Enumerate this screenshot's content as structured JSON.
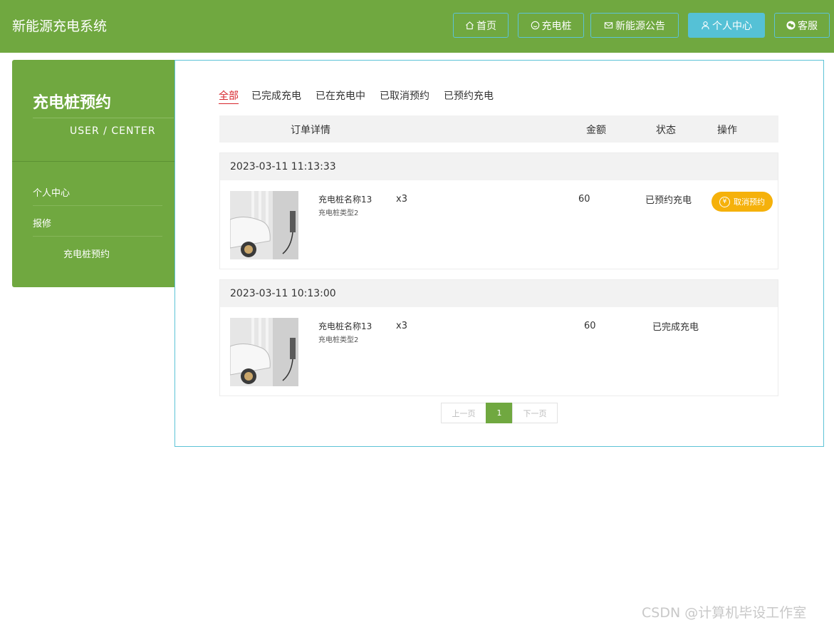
{
  "header": {
    "brand": "新能源充电系统",
    "nav": [
      "首页",
      "充电桩",
      "新能源公告",
      "个人中心",
      "客服"
    ]
  },
  "sidebar": {
    "title": "充电桩预约",
    "subtitle": "USER / CENTER",
    "items": [
      "个人中心",
      "报修",
      "充电桩预约"
    ]
  },
  "tabs": [
    "全部",
    "已完成充电",
    "已在充电中",
    "已取消预约",
    "已预约充电"
  ],
  "table_head": {
    "detail": "订单详情",
    "amount": "金额",
    "status": "状态",
    "action": "操作"
  },
  "orders": [
    {
      "time": "2023-03-11 11:13:33",
      "name": "充电桩名称13",
      "type": "充电桩类型2",
      "qty": "x3",
      "amount": "60",
      "status": "已预约充电",
      "action": "取消预约"
    },
    {
      "time": "2023-03-11 10:13:00",
      "name": "充电桩名称13",
      "type": "充电桩类型2",
      "qty": "x3",
      "amount": "60",
      "status": "已完成充电"
    }
  ],
  "pagination": {
    "prev": "上一页",
    "current": "1",
    "next": "下一页"
  },
  "watermark": "CSDN @计算机毕设工作室",
  "colors": {
    "primary_green": "#70a840",
    "cyan": "#55c1d6",
    "warn": "#f5b10b",
    "tab_active": "#d7262c"
  }
}
